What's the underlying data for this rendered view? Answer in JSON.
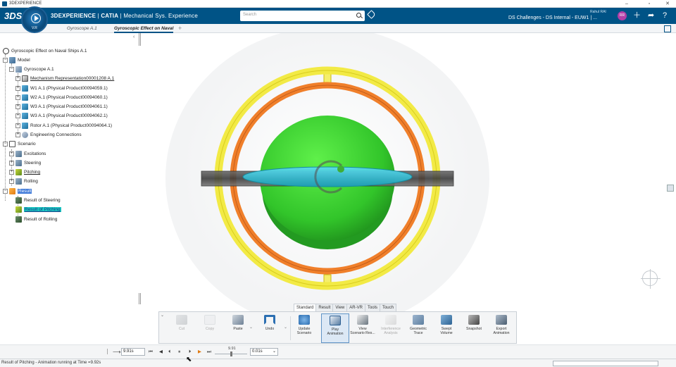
{
  "window": {
    "title": "3DEXPERIENCE",
    "minimize": "–",
    "maximize": "▫",
    "close": "✕"
  },
  "topbar": {
    "logo": "3DS",
    "brand_bold": "3DEXPERIENCE",
    "brand_app": "CATIA",
    "brand_role": "Mechanical Sys. Experience",
    "compass_version": "V.R",
    "search_placeholder": "Search",
    "user_name": "Rahul RAI",
    "collab_space": "DS Challenges - DS Internal - EUW1 | ...",
    "avatar_initials": "RR",
    "icons": [
      "plus-icon",
      "share-icon",
      "help-icon"
    ]
  },
  "tabs": [
    {
      "label": "Gyroscope A.1",
      "active": false
    },
    {
      "label": "Gyroscopic Effect on Naval",
      "active": true
    }
  ],
  "tree": {
    "root": "Gyroscopic Effect on Naval Ships A.1",
    "model": "Model",
    "gyroscope": "Gyroscope A.1",
    "mechanism": "Mechanism Representation00001208 A.1",
    "w1": "W1 A.1 (Physical Product00094059.1)",
    "w2": "W2 A.1 (Physical Product00094060.1)",
    "w3": "W3 A.1 (Physical Product00094061.1)",
    "w3b": "W3 A.1 (Physical Product00094062.1)",
    "rotor": "Rotor A.1 (Physical Product00094064.1)",
    "eng": "Engineering Connections",
    "scenario": "Scenario",
    "excitations": "Excitations",
    "steering": "Steering",
    "pitching": "Pitching",
    "rolling": "Rolling",
    "result": "Result",
    "res_steering": "Result of Steering",
    "res_pitching": "Result of Pitching",
    "res_rolling": "Result of Rolling"
  },
  "action_tabs": [
    "Standard",
    "Result",
    "View",
    "AR-VR",
    "Tools",
    "Touch"
  ],
  "action_tab_active": "Standard",
  "actions": {
    "cut": "Cut",
    "copy": "Copy",
    "paste": "Paste",
    "undo": "Undo",
    "update": "Update\nScenario",
    "play": "Play\nAnimation",
    "view_results": "View\nScenario Res...",
    "interference": "Interference\nAnalysis",
    "trace": "Geometric\nTrace",
    "swept": "Swept\nVolume",
    "snapshot": "Snapshot",
    "export": "Export\nAnimation"
  },
  "player": {
    "time_value": "9.91s",
    "slider_label": "9.91",
    "slider_fraction": 0.5,
    "step_value": "0.01s"
  },
  "status": {
    "message": "Result of Pitching - Animation running at Time =9.92s"
  },
  "colors": {
    "brand_blue": "#005386",
    "ring_outer": "#f2ea45",
    "ring_inner": "#f07f2a",
    "rotor": "#3fcf2e",
    "disc": "#2fc6d8",
    "axle": "#555555"
  }
}
